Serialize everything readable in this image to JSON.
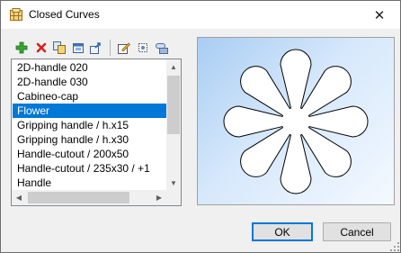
{
  "window": {
    "title": "Closed Curves",
    "close_glyph": "✕"
  },
  "toolbar": {
    "icons": [
      "add-icon",
      "delete-icon",
      "copy-icon",
      "import-icon",
      "export-icon",
      "edit-icon",
      "settings-icon",
      "properties-icon"
    ]
  },
  "list": {
    "items": [
      "2D-handle 020",
      "2D-handle 030",
      "Cabineo-cap",
      "Flower",
      "Gripping handle / h.x15",
      "Gripping handle / h.x30",
      "Handle-cutout / 200x50",
      "Handle-cutout / 235x30 / +1",
      "Handle"
    ],
    "selected": "Flower"
  },
  "preview": {
    "shape": "flower",
    "petals": 8,
    "colors": {
      "fill": "#ffffff",
      "stroke": "#000000"
    }
  },
  "buttons": {
    "ok": "OK",
    "cancel": "Cancel"
  },
  "colors": {
    "selection": "#0078d7",
    "default_border": "#0078d7"
  }
}
